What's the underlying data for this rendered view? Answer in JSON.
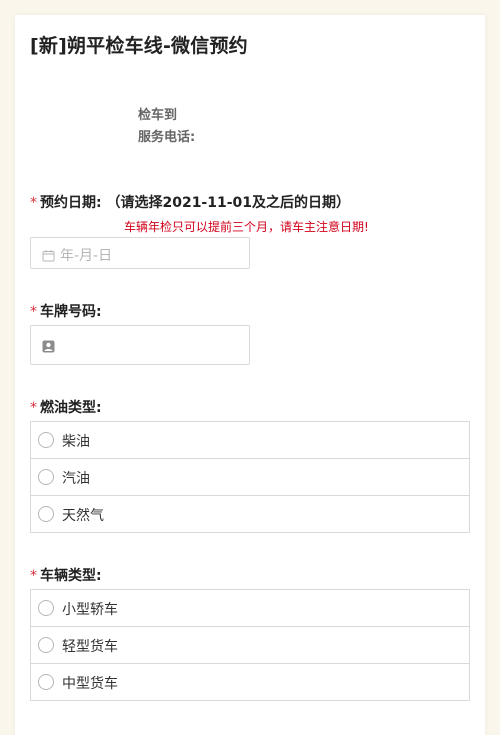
{
  "form": {
    "title": "[新]朔平检车线-微信预约",
    "info_line1": "检车到",
    "info_line2": "服务电话:"
  },
  "date_field": {
    "required_mark": "*",
    "label": "预约日期: （请选择2021-11-01及之后的日期）",
    "hint": "车辆年检只可以提前三个月，请车主注意日期!",
    "placeholder": "年-月-日",
    "icon": "calendar-icon"
  },
  "plate_field": {
    "required_mark": "*",
    "label": "车牌号码:",
    "value": "",
    "icon": "id-card-icon"
  },
  "fuel_field": {
    "required_mark": "*",
    "label": "燃油类型:",
    "options": [
      "柴油",
      "汽油",
      "天然气"
    ]
  },
  "vehicle_field": {
    "required_mark": "*",
    "label": "车辆类型:",
    "options": [
      "小型轿车",
      "轻型货车",
      "中型货车"
    ]
  },
  "colors": {
    "background": "#fbf6ec",
    "required": "#d8323b",
    "hint": "#d0021b",
    "border": "#d9d9d9"
  }
}
